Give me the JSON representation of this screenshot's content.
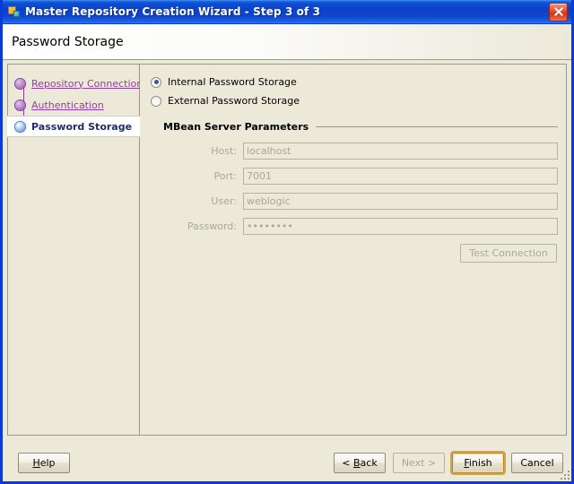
{
  "window": {
    "title": "Master Repository Creation Wizard - Step 3 of 3",
    "icon": "app-icon",
    "close_label": "Close"
  },
  "header": {
    "page_title": "Password Storage"
  },
  "sidebar": {
    "items": [
      {
        "label": "Repository Connection",
        "state": "done",
        "bullet": "step-bullet-done"
      },
      {
        "label": "Authentication",
        "state": "done",
        "bullet": "step-bullet-done"
      },
      {
        "label": "Password Storage",
        "state": "current",
        "bullet": "step-bullet-current"
      }
    ]
  },
  "main": {
    "storage_options": [
      {
        "label": "Internal Password Storage",
        "selected": true
      },
      {
        "label": "External Password Storage",
        "selected": false
      }
    ],
    "group": {
      "title": "MBean Server Parameters",
      "fields": [
        {
          "label": "Host:",
          "value": "localhost",
          "disabled": true
        },
        {
          "label": "Port:",
          "value": "7001",
          "disabled": true
        },
        {
          "label": "User:",
          "value": "weblogic",
          "disabled": true
        },
        {
          "label": "Password:",
          "value": "••••••••",
          "disabled": true
        }
      ],
      "test_button": "Test Connection"
    }
  },
  "footer": {
    "help": "Help",
    "help_mnemonic": "H",
    "back": "< Back",
    "back_mnemonic": "B",
    "next": "Next >",
    "next_mnemonic": "N",
    "finish": "Finish",
    "finish_mnemonic": "F",
    "cancel": "Cancel"
  },
  "colors": {
    "titlebar_blue": "#0b41c8",
    "window_border": "#0a3bd6",
    "face": "#ece9d8",
    "link_purple": "#8f3f9b",
    "current_step": "#1b2f6e",
    "disabled_text": "#a8a898",
    "focus_ring": "#e0a233",
    "close_red": "#d2331a"
  }
}
